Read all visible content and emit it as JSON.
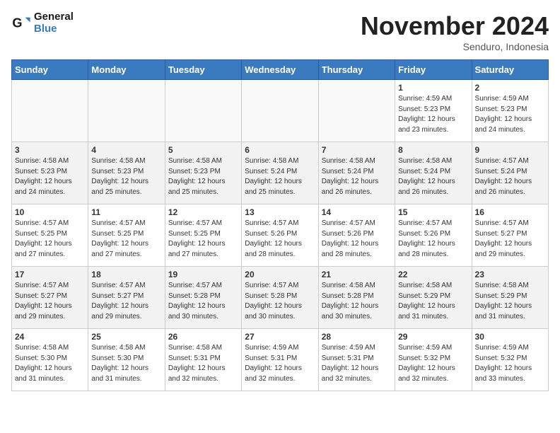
{
  "logo": {
    "line1": "General",
    "line2": "Blue"
  },
  "title": "November 2024",
  "subtitle": "Senduro, Indonesia",
  "days_of_week": [
    "Sunday",
    "Monday",
    "Tuesday",
    "Wednesday",
    "Thursday",
    "Friday",
    "Saturday"
  ],
  "weeks": [
    [
      {
        "day": "",
        "info": ""
      },
      {
        "day": "",
        "info": ""
      },
      {
        "day": "",
        "info": ""
      },
      {
        "day": "",
        "info": ""
      },
      {
        "day": "",
        "info": ""
      },
      {
        "day": "1",
        "info": "Sunrise: 4:59 AM\nSunset: 5:23 PM\nDaylight: 12 hours\nand 23 minutes."
      },
      {
        "day": "2",
        "info": "Sunrise: 4:59 AM\nSunset: 5:23 PM\nDaylight: 12 hours\nand 24 minutes."
      }
    ],
    [
      {
        "day": "3",
        "info": "Sunrise: 4:58 AM\nSunset: 5:23 PM\nDaylight: 12 hours\nand 24 minutes."
      },
      {
        "day": "4",
        "info": "Sunrise: 4:58 AM\nSunset: 5:23 PM\nDaylight: 12 hours\nand 25 minutes."
      },
      {
        "day": "5",
        "info": "Sunrise: 4:58 AM\nSunset: 5:23 PM\nDaylight: 12 hours\nand 25 minutes."
      },
      {
        "day": "6",
        "info": "Sunrise: 4:58 AM\nSunset: 5:24 PM\nDaylight: 12 hours\nand 25 minutes."
      },
      {
        "day": "7",
        "info": "Sunrise: 4:58 AM\nSunset: 5:24 PM\nDaylight: 12 hours\nand 26 minutes."
      },
      {
        "day": "8",
        "info": "Sunrise: 4:58 AM\nSunset: 5:24 PM\nDaylight: 12 hours\nand 26 minutes."
      },
      {
        "day": "9",
        "info": "Sunrise: 4:57 AM\nSunset: 5:24 PM\nDaylight: 12 hours\nand 26 minutes."
      }
    ],
    [
      {
        "day": "10",
        "info": "Sunrise: 4:57 AM\nSunset: 5:25 PM\nDaylight: 12 hours\nand 27 minutes."
      },
      {
        "day": "11",
        "info": "Sunrise: 4:57 AM\nSunset: 5:25 PM\nDaylight: 12 hours\nand 27 minutes."
      },
      {
        "day": "12",
        "info": "Sunrise: 4:57 AM\nSunset: 5:25 PM\nDaylight: 12 hours\nand 27 minutes."
      },
      {
        "day": "13",
        "info": "Sunrise: 4:57 AM\nSunset: 5:26 PM\nDaylight: 12 hours\nand 28 minutes."
      },
      {
        "day": "14",
        "info": "Sunrise: 4:57 AM\nSunset: 5:26 PM\nDaylight: 12 hours\nand 28 minutes."
      },
      {
        "day": "15",
        "info": "Sunrise: 4:57 AM\nSunset: 5:26 PM\nDaylight: 12 hours\nand 28 minutes."
      },
      {
        "day": "16",
        "info": "Sunrise: 4:57 AM\nSunset: 5:27 PM\nDaylight: 12 hours\nand 29 minutes."
      }
    ],
    [
      {
        "day": "17",
        "info": "Sunrise: 4:57 AM\nSunset: 5:27 PM\nDaylight: 12 hours\nand 29 minutes."
      },
      {
        "day": "18",
        "info": "Sunrise: 4:57 AM\nSunset: 5:27 PM\nDaylight: 12 hours\nand 29 minutes."
      },
      {
        "day": "19",
        "info": "Sunrise: 4:57 AM\nSunset: 5:28 PM\nDaylight: 12 hours\nand 30 minutes."
      },
      {
        "day": "20",
        "info": "Sunrise: 4:57 AM\nSunset: 5:28 PM\nDaylight: 12 hours\nand 30 minutes."
      },
      {
        "day": "21",
        "info": "Sunrise: 4:58 AM\nSunset: 5:28 PM\nDaylight: 12 hours\nand 30 minutes."
      },
      {
        "day": "22",
        "info": "Sunrise: 4:58 AM\nSunset: 5:29 PM\nDaylight: 12 hours\nand 31 minutes."
      },
      {
        "day": "23",
        "info": "Sunrise: 4:58 AM\nSunset: 5:29 PM\nDaylight: 12 hours\nand 31 minutes."
      }
    ],
    [
      {
        "day": "24",
        "info": "Sunrise: 4:58 AM\nSunset: 5:30 PM\nDaylight: 12 hours\nand 31 minutes."
      },
      {
        "day": "25",
        "info": "Sunrise: 4:58 AM\nSunset: 5:30 PM\nDaylight: 12 hours\nand 31 minutes."
      },
      {
        "day": "26",
        "info": "Sunrise: 4:58 AM\nSunset: 5:31 PM\nDaylight: 12 hours\nand 32 minutes."
      },
      {
        "day": "27",
        "info": "Sunrise: 4:59 AM\nSunset: 5:31 PM\nDaylight: 12 hours\nand 32 minutes."
      },
      {
        "day": "28",
        "info": "Sunrise: 4:59 AM\nSunset: 5:31 PM\nDaylight: 12 hours\nand 32 minutes."
      },
      {
        "day": "29",
        "info": "Sunrise: 4:59 AM\nSunset: 5:32 PM\nDaylight: 12 hours\nand 32 minutes."
      },
      {
        "day": "30",
        "info": "Sunrise: 4:59 AM\nSunset: 5:32 PM\nDaylight: 12 hours\nand 33 minutes."
      }
    ]
  ]
}
